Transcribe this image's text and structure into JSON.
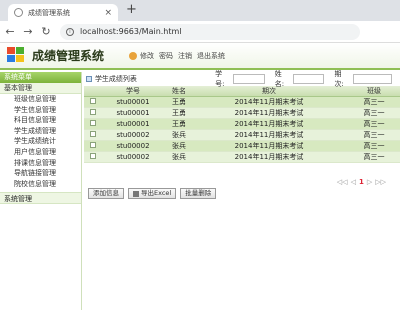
{
  "browser": {
    "tab_title": "成绩管理系统",
    "new_tab_glyph": "+",
    "tab_close_glyph": "×",
    "url": "localhost:9663/Main.html"
  },
  "header": {
    "app_title": "成绩管理系统",
    "links": [
      "修改",
      "密码",
      "注销",
      "退出系统"
    ]
  },
  "sidebar": {
    "menu_header": "系统菜单",
    "group1": "基本管理",
    "items": [
      "班级信息管理",
      "学生信息管理",
      "科目信息管理",
      "学生成绩管理",
      "学生成绩统计",
      "用户信息管理",
      "排课信息管理",
      "导航链接管理",
      "院校信息管理"
    ],
    "group2": "系统管理"
  },
  "toolbar": {
    "list_title": "学生成绩列表",
    "filter1_label": "学号:",
    "filter2_label": "姓名:",
    "filter3_label": "期次:"
  },
  "grid": {
    "columns": [
      "",
      "学号",
      "姓名",
      "期次",
      "班级"
    ],
    "rows": [
      [
        "",
        "stu00001",
        "王勇",
        "2014年11月期末考试",
        "高三一"
      ],
      [
        "",
        "stu00001",
        "王勇",
        "2014年11月期末考试",
        "高三一"
      ],
      [
        "",
        "stu00001",
        "王勇",
        "2014年11月期末考试",
        "高三一"
      ],
      [
        "",
        "stu00002",
        "张兵",
        "2014年11月期末考试",
        "高三一"
      ],
      [
        "",
        "stu00002",
        "张兵",
        "2014年11月期末考试",
        "高三一"
      ],
      [
        "",
        "stu00002",
        "张兵",
        "2014年11月期末考试",
        "高三一"
      ]
    ]
  },
  "pager": {
    "first": "◁◁",
    "prev": "◁",
    "current": "1",
    "next": "▷",
    "last": "▷▷"
  },
  "buttons": {
    "add": "添加信息",
    "export": "导出Excel",
    "delete": "批量删除"
  }
}
